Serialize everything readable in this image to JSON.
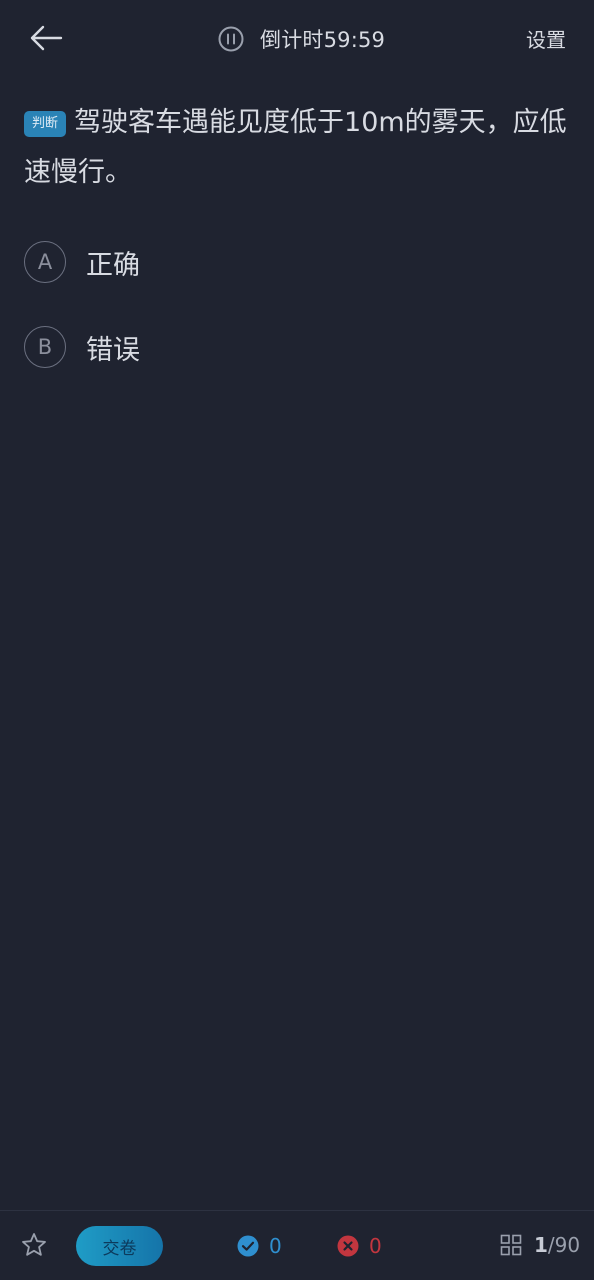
{
  "header": {
    "timer_label": "倒计时59:59",
    "settings_label": "设置"
  },
  "question": {
    "tag": "判断",
    "text": "驾驶客车遇能见度低于10m的雾天，应低速慢行。"
  },
  "options": [
    {
      "letter": "A",
      "text": "正确"
    },
    {
      "letter": "B",
      "text": "错误"
    }
  ],
  "footer": {
    "submit_label": "交卷",
    "correct_count": "0",
    "wrong_count": "0",
    "progress_current": "1",
    "progress_separator": "/",
    "progress_total": "90"
  },
  "icons": {
    "back": "arrow-left-icon",
    "pause": "pause-icon",
    "star": "star-icon",
    "correct": "check-circle-icon",
    "wrong": "x-circle-icon",
    "grid": "grid-icon"
  },
  "colors": {
    "background": "#1f2330",
    "accent": "#2a83b6",
    "correct": "#2f8fcf",
    "wrong": "#c2363f"
  }
}
